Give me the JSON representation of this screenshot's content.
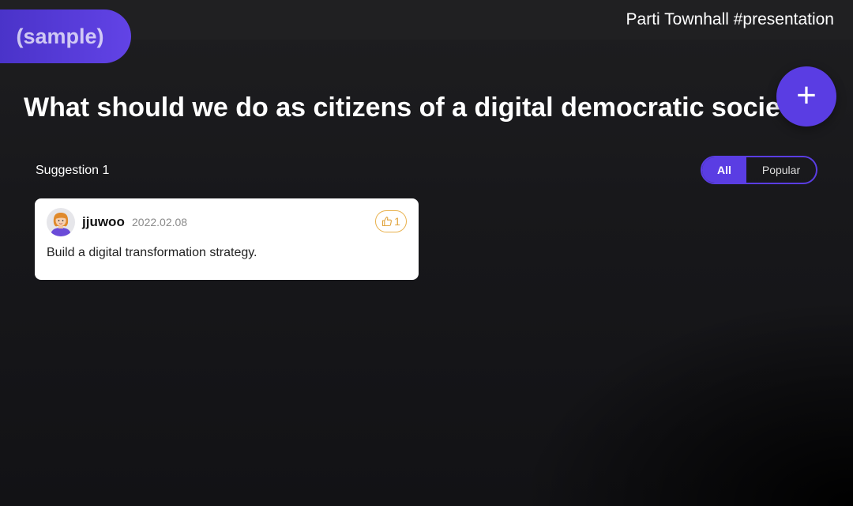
{
  "badge": {
    "label": "(sample)"
  },
  "header": {
    "title": "Parti Townhall #presentation"
  },
  "add_button": {
    "icon": "plus-icon",
    "label": "+"
  },
  "question": {
    "title": "What should we do as citizens of a digital democratic society"
  },
  "suggestions": {
    "count_label": "Suggestion 1"
  },
  "filters": {
    "options": [
      "All",
      "Popular"
    ],
    "selected": "All"
  },
  "cards": [
    {
      "avatar_icon": "user-avatar-icon",
      "author": "jjuwoo",
      "date": "2022.02.08",
      "like_icon": "thumbs-up-icon",
      "likes": "1",
      "body": "Build a digital transformation strategy."
    }
  ],
  "colors": {
    "accent": "#5a3de3",
    "background": "#18181b",
    "like": "#e0a43e",
    "card": "#ffffff"
  }
}
